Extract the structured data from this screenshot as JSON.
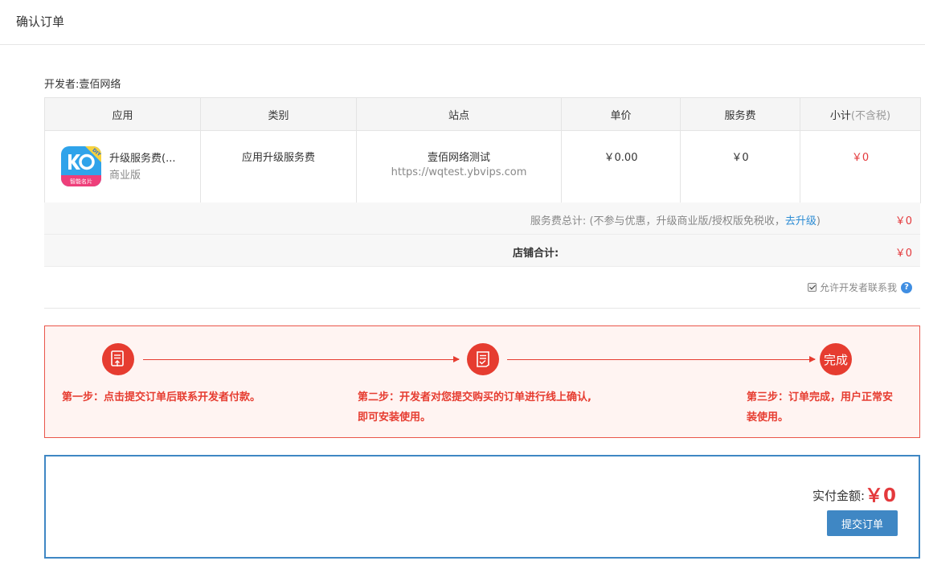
{
  "page": {
    "title": "确认订单"
  },
  "developer": "开发者:壹佰网络",
  "table": {
    "headers": {
      "app": "应用",
      "category": "类别",
      "site": "站点",
      "unit_price": "单价",
      "service_fee": "服务费",
      "subtotal": "小计",
      "subtotal_note": "(不含税)"
    },
    "row": {
      "app_name": "升级服务费(...",
      "app_edition": "商业版",
      "category": "应用升级服务费",
      "site_name": "壹佰网络测试",
      "site_url": "https://wqtest.ybvips.com",
      "unit_price": "￥0.00",
      "service_fee": "￥0",
      "subtotal": "￥0"
    }
  },
  "app_icon": {
    "label": "智能名片",
    "badge": "DIY"
  },
  "service_fee_total": {
    "label": "服务费总计:",
    "note_before": "(不参与优惠，升级商业版/授权版免税收，",
    "link": "去升级",
    "note_after": ")",
    "amount": "￥0"
  },
  "store_total": {
    "label": "店铺合计:",
    "amount": "￥0"
  },
  "contact_developer": {
    "label": "允许开发者联系我",
    "checked": true,
    "help": "?"
  },
  "steps": {
    "step1": "第一步：点击提交订单后联系开发者付款。",
    "step2_line1": "第二步：开发者对您提交购买的订单进行线上确认,",
    "step2_line2": "即可安装使用。",
    "step3_line1": "第三步：订单完成，用户正常安",
    "step3_line2": "装使用。",
    "done_label": "完成"
  },
  "payment": {
    "label": "实付金额:",
    "amount": "￥0",
    "submit": "提交订单"
  },
  "colors": {
    "accent_red": "#e63c30",
    "price_red": "#e4393c",
    "primary_blue": "#3f87c4",
    "link_blue": "#2d8cd4"
  }
}
